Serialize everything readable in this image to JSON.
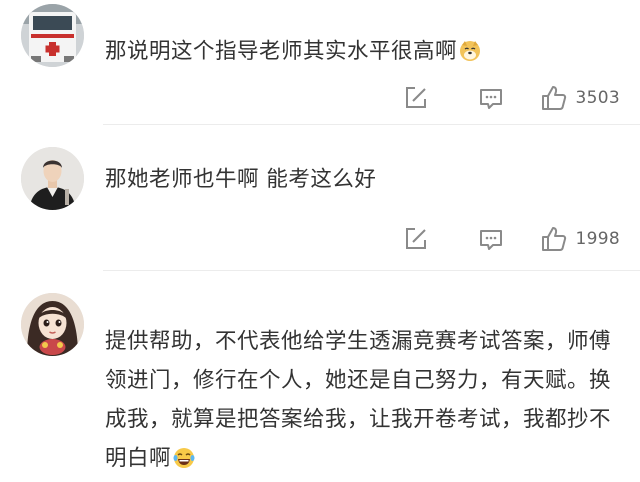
{
  "comments": [
    {
      "text": "那说明这个指导老师其实水平很高啊",
      "emoji": "doge-emoji",
      "likes": "3503",
      "avatar": "ambulance-avatar"
    },
    {
      "text": "那她老师也牛啊 能考这么好",
      "likes": "1998",
      "avatar": "man-avatar"
    },
    {
      "text": "提供帮助，不代表他给学生透漏竞赛考试答案，师傅领进门，修行在个人，她还是自己努力，有天赋。换成我，就算是把答案给我，让我开卷考试，我都抄不明白啊",
      "emoji": "laughing-tears-emoji",
      "avatar": "girl-avatar"
    }
  ],
  "icons": {
    "share": "share-edit-icon",
    "comment": "comment-icon",
    "like": "thumbs-up-icon"
  },
  "colors": {
    "text": "#333333",
    "icon": "#8a8a8a",
    "divider": "#ececec"
  }
}
